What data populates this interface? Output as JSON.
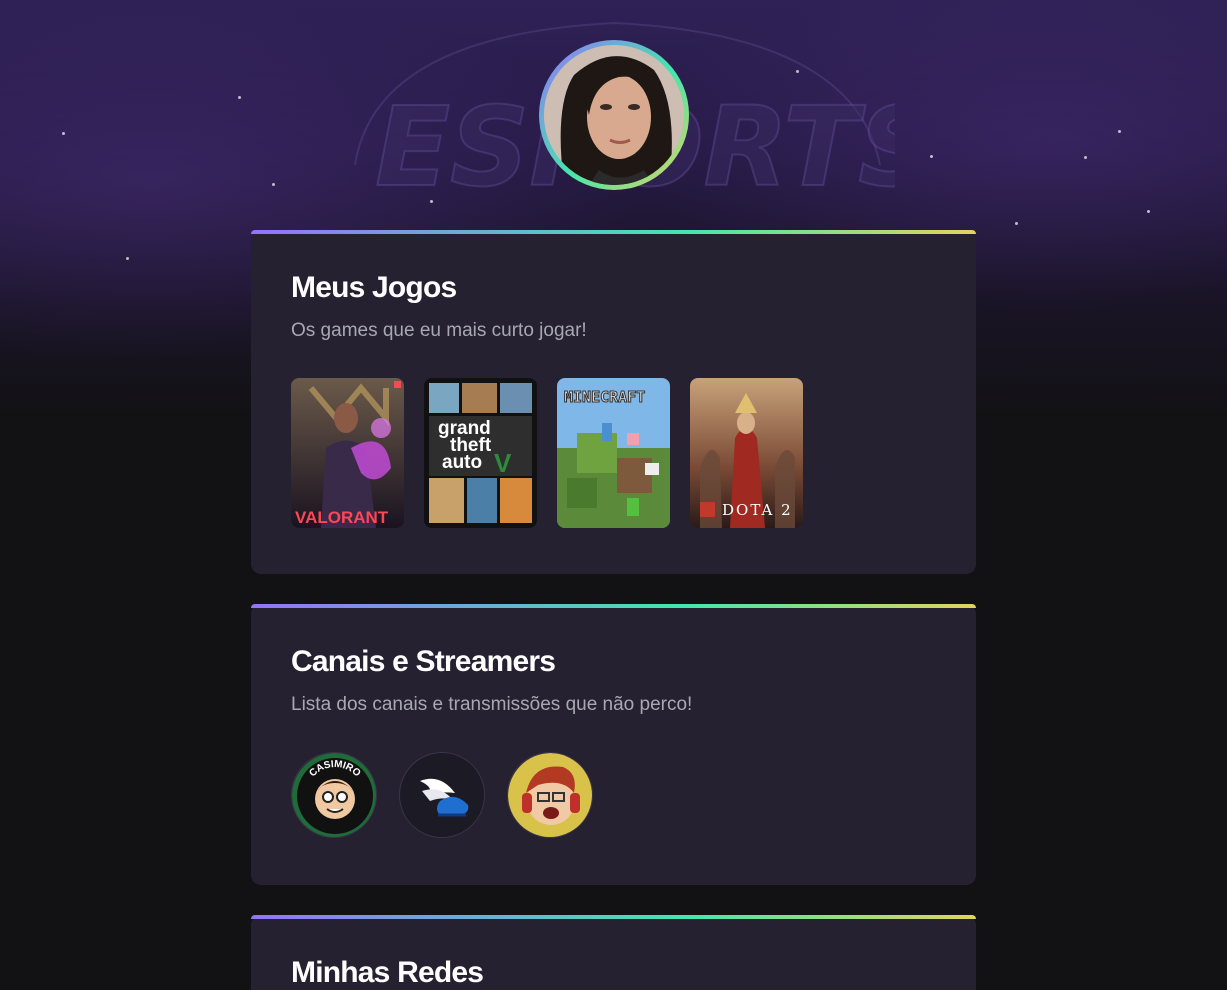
{
  "profile": {
    "avatar_alt": "profile-photo"
  },
  "watermark": {
    "text": "ESPORTS"
  },
  "sections": {
    "games": {
      "title": "Meus Jogos",
      "subtitle": "Os games que eu mais curto jogar!",
      "items": [
        {
          "name": "VALORANT",
          "accent": "#ff4655"
        },
        {
          "name": "grand theft auto",
          "accent": "#e8e0c8"
        },
        {
          "name": "MINECRAFT",
          "accent": "#7fc241"
        },
        {
          "name": "DOTA 2",
          "accent": "#c0392b"
        }
      ]
    },
    "streamers": {
      "title": "Canais e Streamers",
      "subtitle": "Lista dos canais e transmissões que não perco!",
      "items": [
        {
          "name": "CASIMIRO"
        },
        {
          "name": "winged-shoe-channel"
        },
        {
          "name": "gamer-with-headset-channel"
        }
      ]
    },
    "networks": {
      "title": "Minhas Redes"
    }
  },
  "colors": {
    "background": "#121214",
    "card": "#252131",
    "gradient": [
      "#9572fc",
      "#43e7ad",
      "#e2d45c"
    ],
    "text_primary": "#ffffff",
    "text_secondary": "#a8a8b3"
  }
}
